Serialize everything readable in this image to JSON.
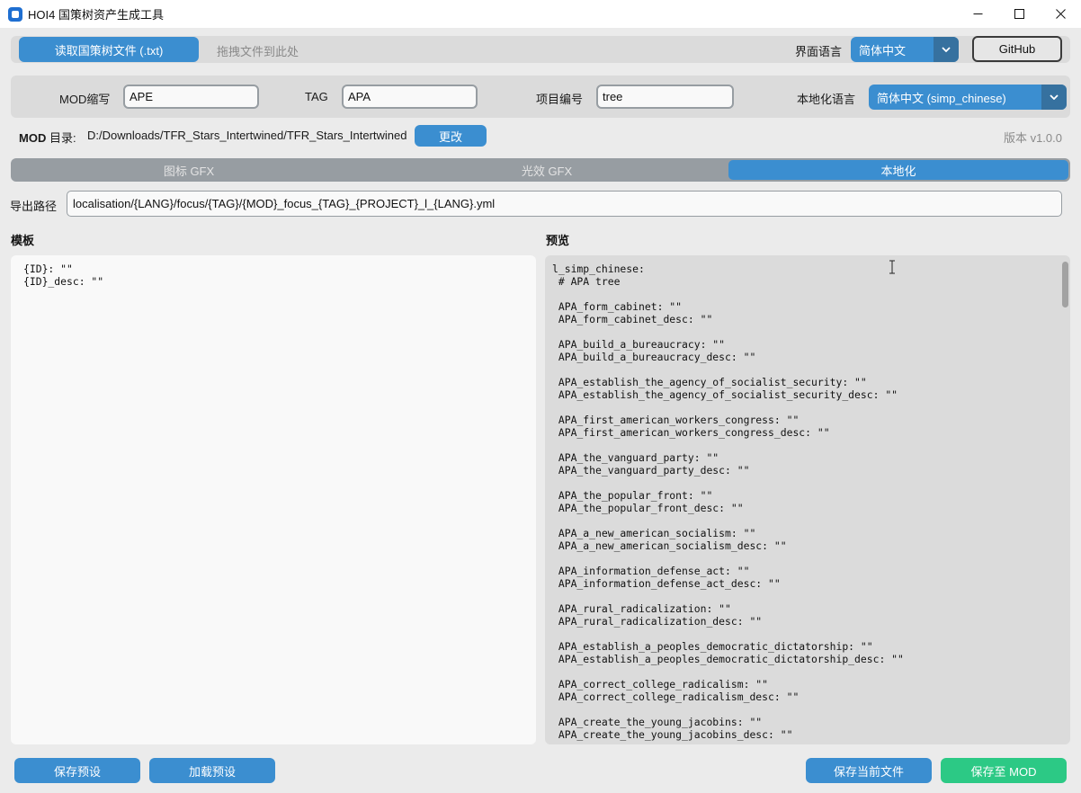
{
  "window": {
    "title": "HOI4 国策树资产生成工具",
    "controls": {
      "minimize_icon": "minimize-icon",
      "maximize_icon": "maximize-icon",
      "close_icon": "close-icon"
    }
  },
  "toolbar": {
    "open_file_label": "读取国策树文件 (.txt)",
    "drop_hint": "拖拽文件到此处",
    "ui_language_label": "界面语言",
    "ui_language_value": "简体中文",
    "github_label": "GitHub"
  },
  "fields": {
    "mod_abbr_label": "MOD缩写",
    "mod_abbr_value": "APE",
    "tag_label": "TAG",
    "tag_value": "APA",
    "project_label": "项目编号",
    "project_value": "tree",
    "loc_lang_label": "本地化语言",
    "loc_lang_value": "简体中文 (simp_chinese)"
  },
  "mod_dir": {
    "label_bold": "MOD",
    "label_rest": " 目录:",
    "path": "D:/Downloads/TFR_Stars_Intertwined/TFR_Stars_Intertwined",
    "change_label": "更改",
    "version": "版本 v1.0.0"
  },
  "tabs": [
    {
      "label": "图标 GFX",
      "active": false
    },
    {
      "label": "光效 GFX",
      "active": false
    },
    {
      "label": "本地化",
      "active": true
    }
  ],
  "export": {
    "label": "导出路径",
    "value": "localisation/{LANG}/focus/{TAG}/{MOD}_focus_{TAG}_{PROJECT}_l_{LANG}.yml"
  },
  "template": {
    "heading": "模板",
    "text": "{ID}: \"\"\n{ID}_desc: \"\""
  },
  "preview": {
    "heading": "预览",
    "text": "l_simp_chinese:\n # APA tree\n\n APA_form_cabinet: \"\"\n APA_form_cabinet_desc: \"\"\n\n APA_build_a_bureaucracy: \"\"\n APA_build_a_bureaucracy_desc: \"\"\n\n APA_establish_the_agency_of_socialist_security: \"\"\n APA_establish_the_agency_of_socialist_security_desc: \"\"\n\n APA_first_american_workers_congress: \"\"\n APA_first_american_workers_congress_desc: \"\"\n\n APA_the_vanguard_party: \"\"\n APA_the_vanguard_party_desc: \"\"\n\n APA_the_popular_front: \"\"\n APA_the_popular_front_desc: \"\"\n\n APA_a_new_american_socialism: \"\"\n APA_a_new_american_socialism_desc: \"\"\n\n APA_information_defense_act: \"\"\n APA_information_defense_act_desc: \"\"\n\n APA_rural_radicalization: \"\"\n APA_rural_radicalization_desc: \"\"\n\n APA_establish_a_peoples_democratic_dictatorship: \"\"\n APA_establish_a_peoples_democratic_dictatorship_desc: \"\"\n\n APA_correct_college_radicalism: \"\"\n APA_correct_college_radicalism_desc: \"\"\n\n APA_create_the_young_jacobins: \"\"\n APA_create_the_young_jacobins_desc: \"\""
  },
  "bottom": {
    "save_preset": "保存预设",
    "load_preset": "加载预设",
    "save_current": "保存当前文件",
    "save_to_mod": "保存至 MOD"
  },
  "colors": {
    "accent": "#3b8ed0",
    "accent_dark": "#36719f",
    "save_to_mod": "#2cc985"
  }
}
